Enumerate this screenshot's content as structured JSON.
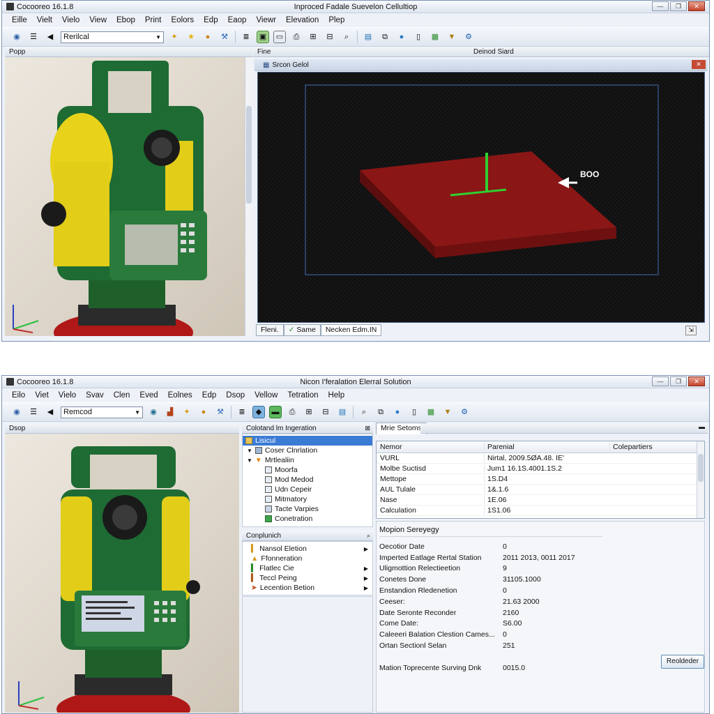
{
  "top": {
    "app_title": "Cocooreo 16.1.8",
    "window_title": "Inproced Fadale Suevelon Cellultiop",
    "menu": [
      "Eille",
      "Vielt",
      "Vielo",
      "View",
      "Ebop",
      "Print",
      "Eolors",
      "Edp",
      "Eaop",
      "Viewr",
      "Elevation",
      "Plep"
    ],
    "view_combo": "Rerilcal",
    "left_panel_title": "Popp",
    "mid_panel_title": "Fine",
    "right_panel_title": "Deinod Siard",
    "viewport_title": "Srcon Gelol",
    "model_label": "BOO",
    "tabs": [
      "Fleni.",
      "Same",
      "Necken Edm.IN"
    ]
  },
  "bottom": {
    "app_title": "Cocooreo 16.1.8",
    "window_title": "Nicon I'feralation Elerral Solution",
    "menu": [
      "Eilo",
      "Viet",
      "Vielo",
      "Svav",
      "Clen",
      "Eved",
      "Eolnes",
      "Edp",
      "Dsop",
      "Vellow",
      "Tetration",
      "Help"
    ],
    "view_combo": "Remcod",
    "left_panel_title": "Dsop",
    "tree_panel_title": "Colotand lm Ingeration",
    "tree_items": [
      {
        "label": "Lisicul",
        "selected": true,
        "indent": 0,
        "icon": "folder-icon"
      },
      {
        "label": "Coser Clnrlation",
        "selected": false,
        "indent": 1,
        "icon": "grid-icon"
      },
      {
        "label": "Mrtlealiin",
        "selected": false,
        "indent": 1,
        "icon": "warning-icon"
      },
      {
        "label": "Moorfa",
        "selected": false,
        "indent": 2,
        "icon": "doc-icon"
      },
      {
        "label": "Mod Medod",
        "selected": false,
        "indent": 2,
        "icon": "doc-icon"
      },
      {
        "label": "Udn Cepeir",
        "selected": false,
        "indent": 2,
        "icon": "doc-icon"
      },
      {
        "label": "Mitmatory",
        "selected": false,
        "indent": 2,
        "icon": "doc-icon"
      },
      {
        "label": "Tacte Varpies",
        "selected": false,
        "indent": 2,
        "icon": "list-icon"
      },
      {
        "label": "Conetration",
        "selected": false,
        "indent": 2,
        "icon": "green-icon"
      }
    ],
    "list_panel_title": "Conplunich",
    "list_items": [
      "Nansol Eletion",
      "Ffonneration",
      "Flatlec Cie",
      "Teccl Peing",
      "Lecention Betion"
    ],
    "right_tab": "Mrie Setoms",
    "table_headers": [
      "Nemor",
      "Parenial",
      "Colepartiers"
    ],
    "table_rows": [
      [
        "VURL",
        "Nirtal, 2009.5ØA.48. IE'",
        ""
      ],
      [
        "Molbe Suctisd",
        "Jum1 16.1S.4001.1S.2",
        ""
      ],
      [
        "Mettope",
        "1S.D4",
        ""
      ],
      [
        "AUL Tulale",
        "1&.1.6",
        ""
      ],
      [
        "Nase",
        "1E.06",
        ""
      ],
      [
        "Calculation",
        "1S1.06",
        ""
      ]
    ],
    "props_title": "Mopion Sereyegy",
    "props": [
      [
        "Oecotior Date",
        "0"
      ],
      [
        "Imperted Eatlage Rertal Station",
        "2011 2013, 0011 2017"
      ],
      [
        "Uligmottion Relectieetion",
        "9"
      ],
      [
        "Conetes Done",
        "31105.1000"
      ],
      [
        "Enstandion Rledenetion",
        "0"
      ],
      [
        "Ceeser:",
        "21.63 2000"
      ],
      [
        "Date Seronte Reconder",
        "2160"
      ],
      [
        "Come Date:",
        "S6.00"
      ],
      [
        "Caleeeri Balation Clestion Cames...",
        "0"
      ],
      [
        "Ortan Sectionl Selan",
        "251"
      ]
    ],
    "footer_key": "Mation Toprecente Surving Dnk",
    "footer_val": "0015.0",
    "action_button": "Reoldeder"
  }
}
